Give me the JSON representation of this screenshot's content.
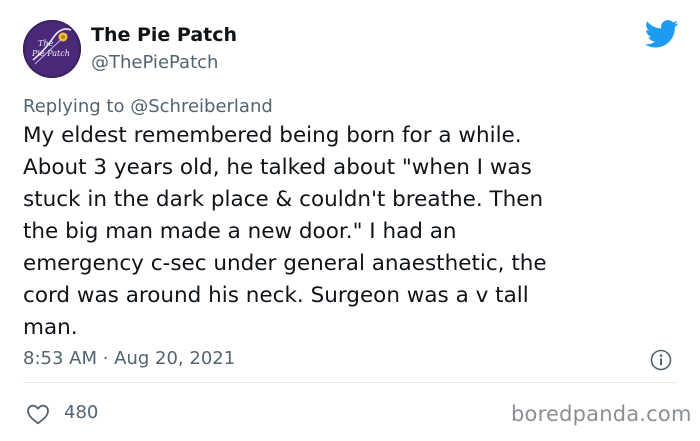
{
  "tweet": {
    "author": {
      "display_name": "The Pie Patch",
      "handle": "@ThePiePatch",
      "avatar_icon": "pie-patch-logo-avatar"
    },
    "brand_icon": "twitter-bird-icon",
    "brand_color": "#1d9bf0",
    "reply": {
      "prefix": "Replying to",
      "mention": "@Schreiberland"
    },
    "text_lines": [
      "My eldest remembered being born for a while.",
      "About 3 years old, he talked about \"when I was",
      "stuck in the dark place & couldn't breathe. Then",
      "the big man made a new door.\" I had an",
      "emergency c-sec under general anaesthetic, the",
      "cord was around his neck. Surgeon was a v tall",
      "man."
    ],
    "timestamp": "8:53 AM · Aug 20, 2021",
    "info_icon": "info-icon",
    "likes": {
      "icon": "heart-icon",
      "count": "480"
    }
  },
  "watermark": "boredpanda.com"
}
